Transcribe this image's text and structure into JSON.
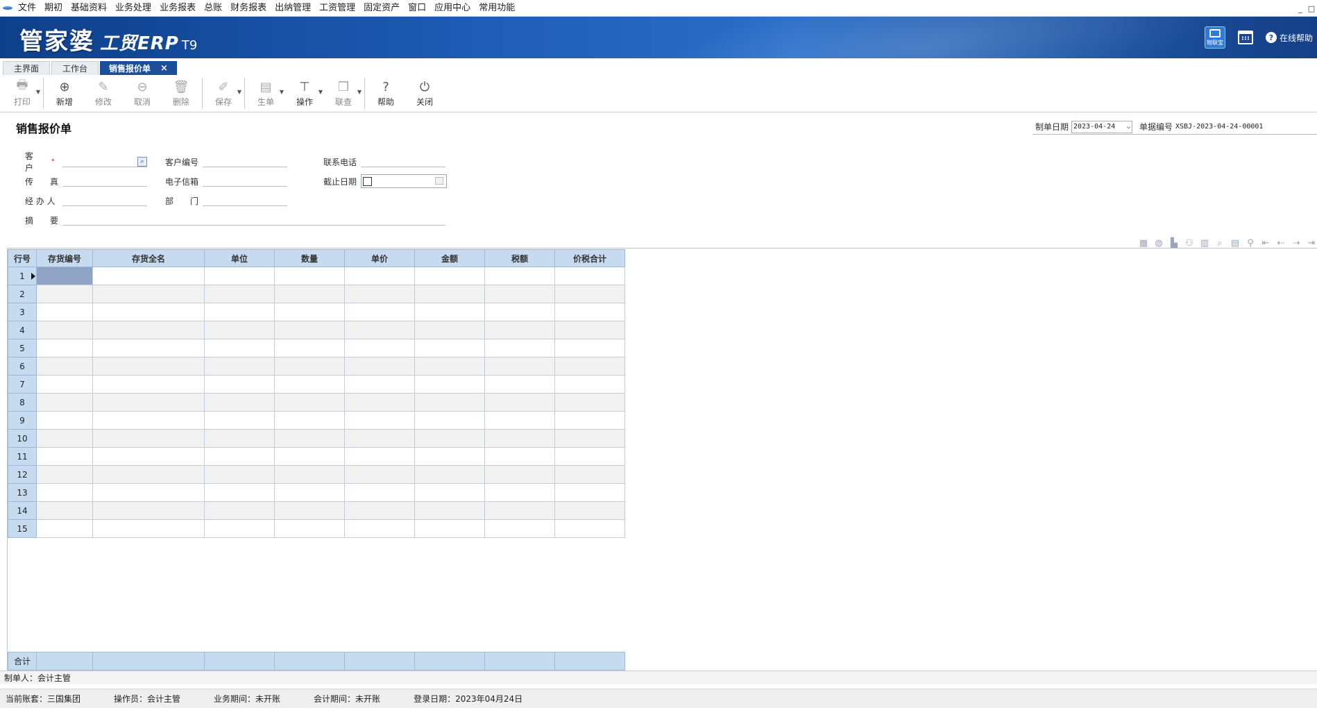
{
  "menu": [
    "文件",
    "期初",
    "基础资料",
    "业务处理",
    "业务报表",
    "总账",
    "财务报表",
    "出纳管理",
    "工资管理",
    "固定资产",
    "窗口",
    "应用中心",
    "常用功能"
  ],
  "window_controls": [
    "_",
    "□"
  ],
  "banner": {
    "logo_main": "管家婆",
    "logo_sub": "工贸ERP",
    "logo_ver": "T9",
    "wlb_label": "物联宝",
    "help_label": "在线帮助",
    "help_icon": "?"
  },
  "tabs": [
    {
      "label": "主界面",
      "active": false
    },
    {
      "label": "工作台",
      "active": false
    },
    {
      "label": "销售报价单",
      "active": true,
      "close": "×"
    }
  ],
  "toolbar": [
    {
      "label": "打印",
      "icon": "printer-icon",
      "glyph": "🖶",
      "disabled": true,
      "caret": true
    },
    {
      "label": "新增",
      "icon": "add-icon",
      "glyph": "⊕",
      "disabled": false
    },
    {
      "label": "修改",
      "icon": "edit-icon",
      "glyph": "✎",
      "disabled": true
    },
    {
      "label": "取消",
      "icon": "cancel-icon",
      "glyph": "⊖",
      "disabled": true
    },
    {
      "label": "删除",
      "icon": "trash-icon",
      "glyph": "🗑",
      "disabled": true
    },
    {
      "label": "保存",
      "icon": "save-icon",
      "glyph": "✐",
      "disabled": true,
      "caret": true
    },
    {
      "label": "生单",
      "icon": "generate-doc-icon",
      "glyph": "▤",
      "disabled": true,
      "caret": true
    },
    {
      "label": "操作",
      "icon": "operation-icon",
      "glyph": "⊤",
      "disabled": false,
      "caret": true
    },
    {
      "label": "联查",
      "icon": "linked-query-icon",
      "glyph": "❐",
      "disabled": true,
      "caret": true
    },
    {
      "label": "帮助",
      "icon": "help-icon",
      "glyph": "?",
      "disabled": false
    },
    {
      "label": "关闭",
      "icon": "power-icon",
      "glyph": "⏻",
      "disabled": false
    }
  ],
  "doc": {
    "title": "销售报价单",
    "date_label": "制单日期",
    "date_value": "2023-04-24",
    "no_label": "单据编号",
    "no_value": "XSBJ-2023-04-24-00001"
  },
  "fields": {
    "customer": "客　　户",
    "required_mark": "*",
    "customer_code": "客户编号",
    "phone": "联系电话",
    "fax": "传　　真",
    "email": "电子信箱",
    "deadline": "截止日期",
    "handler": "经 办 人",
    "dept": "部　　门",
    "summary": "摘　　要"
  },
  "grid": {
    "columns": [
      "行号",
      "存货编号",
      "存货全名",
      "单位",
      "数量",
      "单价",
      "金额",
      "税额",
      "价税合计"
    ],
    "rows": [
      "1",
      "2",
      "3",
      "4",
      "5",
      "6",
      "7",
      "8",
      "9",
      "10",
      "11",
      "12",
      "13",
      "14",
      "15"
    ],
    "total_label": "合计"
  },
  "footer": {
    "maker": "制单人：会计主管"
  },
  "status": {
    "account": "当前账套：三国集团",
    "operator": "操作员：会计主管",
    "biz_period": "业务期间：未开账",
    "acc_period": "会计期间：未开账",
    "login_date": "登录日期：2023年04月24日"
  }
}
